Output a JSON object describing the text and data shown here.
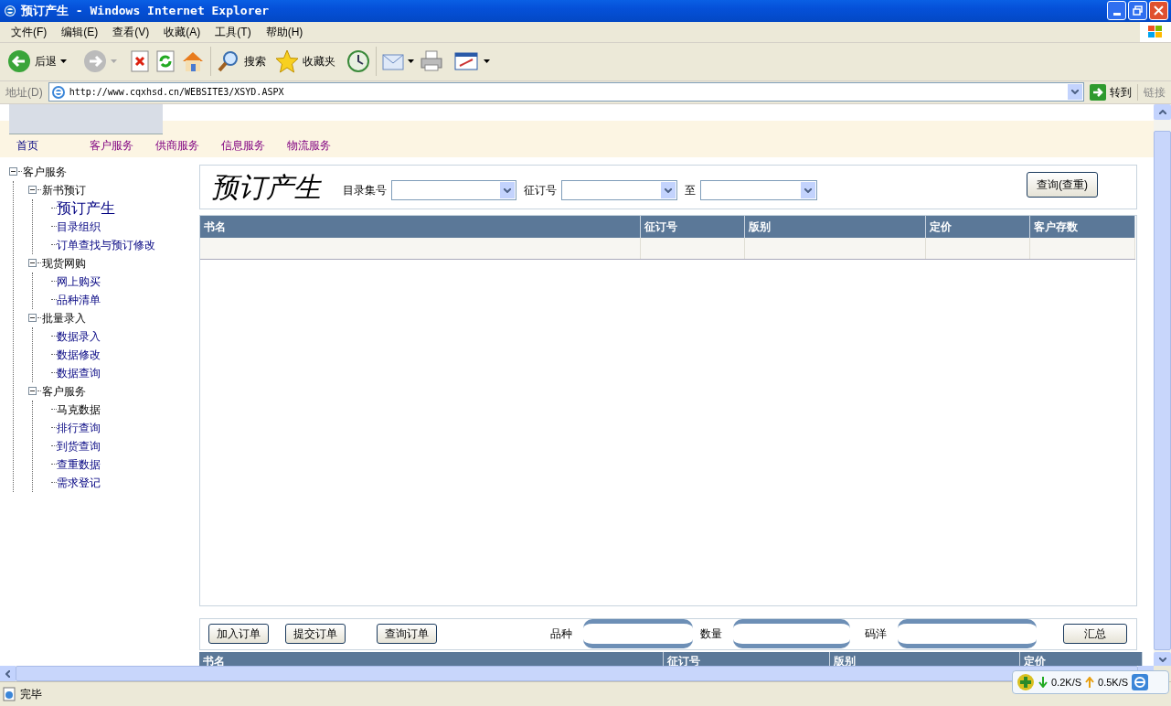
{
  "window": {
    "title": "预订产生 - Windows Internet Explorer"
  },
  "menu": [
    "文件(F)",
    "编辑(E)",
    "查看(V)",
    "收藏(A)",
    "工具(T)",
    "帮助(H)"
  ],
  "toolbar": {
    "back": "后退",
    "search": "搜索",
    "favorites": "收藏夹"
  },
  "address_bar": {
    "label": "地址(D)",
    "url": "http://www.cqxhsd.cn/WEBSITE3/XSYD.ASPX",
    "go": "转到",
    "links": "链接"
  },
  "nav": [
    {
      "label": "首页",
      "visited": false
    },
    {
      "label": "客户服务",
      "visited": true
    },
    {
      "label": "供商服务",
      "visited": true
    },
    {
      "label": "信息服务",
      "visited": true
    },
    {
      "label": "物流服务",
      "visited": true
    }
  ],
  "tree": {
    "label": "客户服务",
    "expanded": true,
    "children": [
      {
        "label": "新书预订",
        "expanded": true,
        "children": [
          {
            "label": "预订产生",
            "selected": true,
            "link": true
          },
          {
            "label": "目录组织",
            "selected": false,
            "link": true
          },
          {
            "label": "订单查找与预订修改",
            "selected": false,
            "link": true
          }
        ]
      },
      {
        "label": "现货网购",
        "expanded": true,
        "children": [
          {
            "label": "网上购买",
            "selected": false,
            "link": true
          },
          {
            "label": "品种清单",
            "selected": false,
            "link": true
          }
        ]
      },
      {
        "label": "批量录入",
        "expanded": true,
        "children": [
          {
            "label": "数据录入",
            "selected": false,
            "link": true
          },
          {
            "label": "数据修改",
            "selected": false,
            "link": true
          },
          {
            "label": "数据查询",
            "selected": false,
            "link": true
          }
        ]
      },
      {
        "label": "客户服务",
        "expanded": true,
        "children": [
          {
            "label": "马克数据",
            "selected": false,
            "link": false
          },
          {
            "label": "排行查询",
            "selected": false,
            "link": true
          },
          {
            "label": "到货查询",
            "selected": false,
            "link": true
          },
          {
            "label": "查重数据",
            "selected": false,
            "link": true
          },
          {
            "label": "需求登记",
            "selected": false,
            "link": true
          }
        ]
      }
    ]
  },
  "form": {
    "title": "预订产生",
    "fields": [
      {
        "label": "目录集号"
      },
      {
        "label": "征订号"
      },
      {
        "label": "至"
      }
    ],
    "query_button": "查询(查重)"
  },
  "table": {
    "columns": [
      "书名",
      "征订号",
      "版别",
      "定价",
      "客户存数"
    ]
  },
  "order_bar": {
    "buttons": [
      "加入订单",
      "提交订单",
      "查询订单"
    ],
    "fields": [
      {
        "label": "品种"
      },
      {
        "label": "数量"
      },
      {
        "label": "码洋"
      }
    ],
    "sum_button": "汇总"
  },
  "order_table": {
    "columns": [
      "书名",
      "征订号",
      "版别",
      "定价"
    ]
  },
  "status_bar": {
    "text": "完毕",
    "download": "0.2K/S",
    "upload": "0.5K/S"
  }
}
